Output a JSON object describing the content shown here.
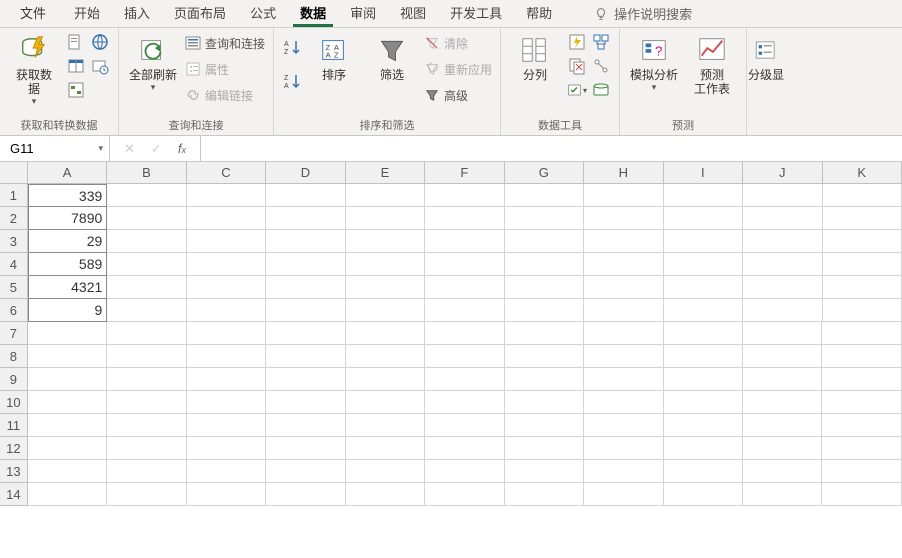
{
  "tabs": {
    "file": "文件",
    "home": "开始",
    "insert": "插入",
    "page_layout": "页面布局",
    "formulas": "公式",
    "data": "数据",
    "review": "审阅",
    "view": "视图",
    "developer": "开发工具",
    "help": "帮助",
    "tell_me": "操作说明搜索"
  },
  "ribbon": {
    "get_transform": {
      "main": "获取数\n据",
      "group_label": "获取和转换数据"
    },
    "queries": {
      "refresh_all": "全部刷新",
      "queries_conns": "查询和连接",
      "properties": "属性",
      "edit_links": "编辑链接",
      "group_label": "查询和连接"
    },
    "sort_filter": {
      "sort": "排序",
      "filter": "筛选",
      "clear": "清除",
      "reapply": "重新应用",
      "advanced": "高级",
      "group_label": "排序和筛选"
    },
    "data_tools": {
      "text_to_cols": "分列",
      "group_label": "数据工具"
    },
    "forecast": {
      "whatif": "模拟分析",
      "forecast_sheet": "预测\n工作表",
      "group_label": "预测"
    },
    "outline": {
      "group": "分级显"
    }
  },
  "formula_bar": {
    "name_box": "G11",
    "formula": ""
  },
  "grid": {
    "columns": [
      "A",
      "B",
      "C",
      "D",
      "E",
      "F",
      "G",
      "H",
      "I",
      "J",
      "K"
    ],
    "row_count": 14,
    "cells": {
      "A1": "339",
      "A2": "7890",
      "A3": "29",
      "A4": "589",
      "A5": "4321",
      "A6": "9"
    }
  }
}
